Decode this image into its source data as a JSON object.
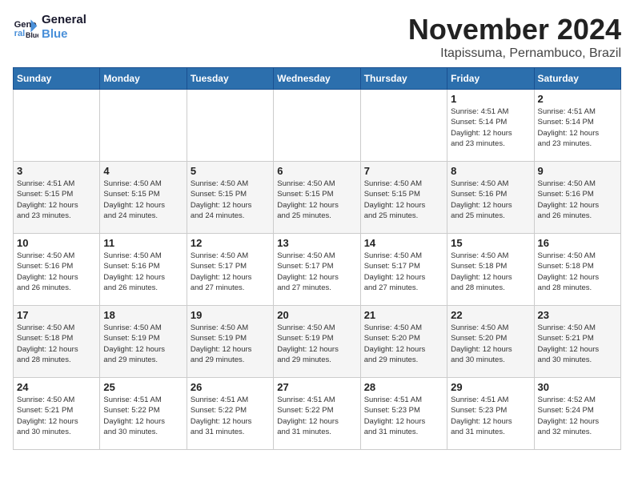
{
  "logo": {
    "line1": "General",
    "line2": "Blue"
  },
  "title": "November 2024",
  "subtitle": "Itapissuma, Pernambuco, Brazil",
  "weekdays": [
    "Sunday",
    "Monday",
    "Tuesday",
    "Wednesday",
    "Thursday",
    "Friday",
    "Saturday"
  ],
  "weeks": [
    [
      {
        "day": "",
        "info": ""
      },
      {
        "day": "",
        "info": ""
      },
      {
        "day": "",
        "info": ""
      },
      {
        "day": "",
        "info": ""
      },
      {
        "day": "",
        "info": ""
      },
      {
        "day": "1",
        "info": "Sunrise: 4:51 AM\nSunset: 5:14 PM\nDaylight: 12 hours\nand 23 minutes."
      },
      {
        "day": "2",
        "info": "Sunrise: 4:51 AM\nSunset: 5:14 PM\nDaylight: 12 hours\nand 23 minutes."
      }
    ],
    [
      {
        "day": "3",
        "info": "Sunrise: 4:51 AM\nSunset: 5:15 PM\nDaylight: 12 hours\nand 23 minutes."
      },
      {
        "day": "4",
        "info": "Sunrise: 4:50 AM\nSunset: 5:15 PM\nDaylight: 12 hours\nand 24 minutes."
      },
      {
        "day": "5",
        "info": "Sunrise: 4:50 AM\nSunset: 5:15 PM\nDaylight: 12 hours\nand 24 minutes."
      },
      {
        "day": "6",
        "info": "Sunrise: 4:50 AM\nSunset: 5:15 PM\nDaylight: 12 hours\nand 25 minutes."
      },
      {
        "day": "7",
        "info": "Sunrise: 4:50 AM\nSunset: 5:15 PM\nDaylight: 12 hours\nand 25 minutes."
      },
      {
        "day": "8",
        "info": "Sunrise: 4:50 AM\nSunset: 5:16 PM\nDaylight: 12 hours\nand 25 minutes."
      },
      {
        "day": "9",
        "info": "Sunrise: 4:50 AM\nSunset: 5:16 PM\nDaylight: 12 hours\nand 26 minutes."
      }
    ],
    [
      {
        "day": "10",
        "info": "Sunrise: 4:50 AM\nSunset: 5:16 PM\nDaylight: 12 hours\nand 26 minutes."
      },
      {
        "day": "11",
        "info": "Sunrise: 4:50 AM\nSunset: 5:16 PM\nDaylight: 12 hours\nand 26 minutes."
      },
      {
        "day": "12",
        "info": "Sunrise: 4:50 AM\nSunset: 5:17 PM\nDaylight: 12 hours\nand 27 minutes."
      },
      {
        "day": "13",
        "info": "Sunrise: 4:50 AM\nSunset: 5:17 PM\nDaylight: 12 hours\nand 27 minutes."
      },
      {
        "day": "14",
        "info": "Sunrise: 4:50 AM\nSunset: 5:17 PM\nDaylight: 12 hours\nand 27 minutes."
      },
      {
        "day": "15",
        "info": "Sunrise: 4:50 AM\nSunset: 5:18 PM\nDaylight: 12 hours\nand 28 minutes."
      },
      {
        "day": "16",
        "info": "Sunrise: 4:50 AM\nSunset: 5:18 PM\nDaylight: 12 hours\nand 28 minutes."
      }
    ],
    [
      {
        "day": "17",
        "info": "Sunrise: 4:50 AM\nSunset: 5:18 PM\nDaylight: 12 hours\nand 28 minutes."
      },
      {
        "day": "18",
        "info": "Sunrise: 4:50 AM\nSunset: 5:19 PM\nDaylight: 12 hours\nand 29 minutes."
      },
      {
        "day": "19",
        "info": "Sunrise: 4:50 AM\nSunset: 5:19 PM\nDaylight: 12 hours\nand 29 minutes."
      },
      {
        "day": "20",
        "info": "Sunrise: 4:50 AM\nSunset: 5:19 PM\nDaylight: 12 hours\nand 29 minutes."
      },
      {
        "day": "21",
        "info": "Sunrise: 4:50 AM\nSunset: 5:20 PM\nDaylight: 12 hours\nand 29 minutes."
      },
      {
        "day": "22",
        "info": "Sunrise: 4:50 AM\nSunset: 5:20 PM\nDaylight: 12 hours\nand 30 minutes."
      },
      {
        "day": "23",
        "info": "Sunrise: 4:50 AM\nSunset: 5:21 PM\nDaylight: 12 hours\nand 30 minutes."
      }
    ],
    [
      {
        "day": "24",
        "info": "Sunrise: 4:50 AM\nSunset: 5:21 PM\nDaylight: 12 hours\nand 30 minutes."
      },
      {
        "day": "25",
        "info": "Sunrise: 4:51 AM\nSunset: 5:22 PM\nDaylight: 12 hours\nand 30 minutes."
      },
      {
        "day": "26",
        "info": "Sunrise: 4:51 AM\nSunset: 5:22 PM\nDaylight: 12 hours\nand 31 minutes."
      },
      {
        "day": "27",
        "info": "Sunrise: 4:51 AM\nSunset: 5:22 PM\nDaylight: 12 hours\nand 31 minutes."
      },
      {
        "day": "28",
        "info": "Sunrise: 4:51 AM\nSunset: 5:23 PM\nDaylight: 12 hours\nand 31 minutes."
      },
      {
        "day": "29",
        "info": "Sunrise: 4:51 AM\nSunset: 5:23 PM\nDaylight: 12 hours\nand 31 minutes."
      },
      {
        "day": "30",
        "info": "Sunrise: 4:52 AM\nSunset: 5:24 PM\nDaylight: 12 hours\nand 32 minutes."
      }
    ]
  ]
}
